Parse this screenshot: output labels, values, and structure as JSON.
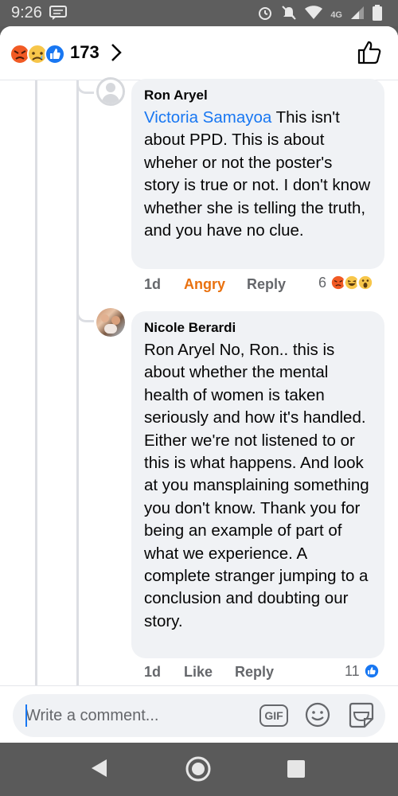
{
  "status_bar": {
    "time": "9:26",
    "network": "4G",
    "battery": "full"
  },
  "reactions_header": {
    "count": "173",
    "icons": [
      "angry-emoji",
      "sad-emoji",
      "like-emoji"
    ]
  },
  "comments": [
    {
      "author": "Ron Aryel",
      "mention": "Victoria Samayoa",
      "text": " This isn't about PPD.  This is about wheher or not the poster's story is true or not.  I don't know whether she is telling the truth, and you have no clue.",
      "time": "1d",
      "reaction_label": "Angry",
      "reply_label": "Reply",
      "reaction_count": "6",
      "reaction_icons": [
        "angry-emoji",
        "haha-emoji",
        "wow-emoji"
      ]
    },
    {
      "author": "Nicole Berardi",
      "text": "Ron Aryel No, Ron.. this is about whether the mental health of women is taken seriously and how it's handled. Either we're not listened to or this is what happens. And look at you mansplaining something you don't know. Thank you for being an example of part of what we experience. A complete stranger jumping to a conclusion and doubting our story.",
      "time": "1d",
      "like_label": "Like",
      "reply_label": "Reply",
      "reaction_count": "11",
      "reaction_icons": [
        "like-emoji"
      ]
    }
  ],
  "composer": {
    "placeholder": "Write a comment...",
    "gif_label": "GIF"
  },
  "colors": {
    "accent": "#1877f2",
    "angry": "#e9710f",
    "bubble": "#f0f2f5",
    "muted": "#65676b"
  }
}
